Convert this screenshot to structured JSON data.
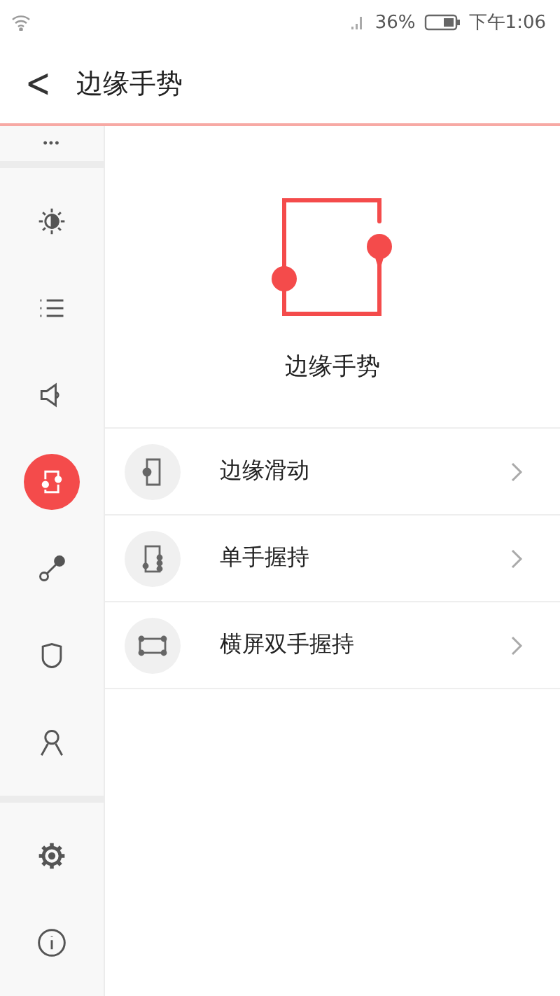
{
  "status_bar": {
    "battery": "36%",
    "time": "下午1:06"
  },
  "header": {
    "back": "<",
    "title": "边缘手势"
  },
  "sidebar": {
    "more": "•••",
    "groups": [
      [
        {
          "kind": "brightness",
          "selected": false
        },
        {
          "kind": "list",
          "selected": false
        },
        {
          "kind": "speaker",
          "selected": false
        },
        {
          "kind": "edge",
          "selected": true
        },
        {
          "kind": "connect",
          "selected": false
        },
        {
          "kind": "shield",
          "selected": false
        },
        {
          "kind": "person",
          "selected": false
        }
      ],
      [
        {
          "kind": "gear",
          "selected": false
        },
        {
          "kind": "info",
          "selected": false
        }
      ]
    ]
  },
  "hero": {
    "title": "边缘手势"
  },
  "rows": [
    {
      "kind": "edge-slide",
      "label": "边缘滑动"
    },
    {
      "kind": "one-hand",
      "label": "单手握持"
    },
    {
      "kind": "landscape",
      "label": "横屏双手握持"
    }
  ]
}
